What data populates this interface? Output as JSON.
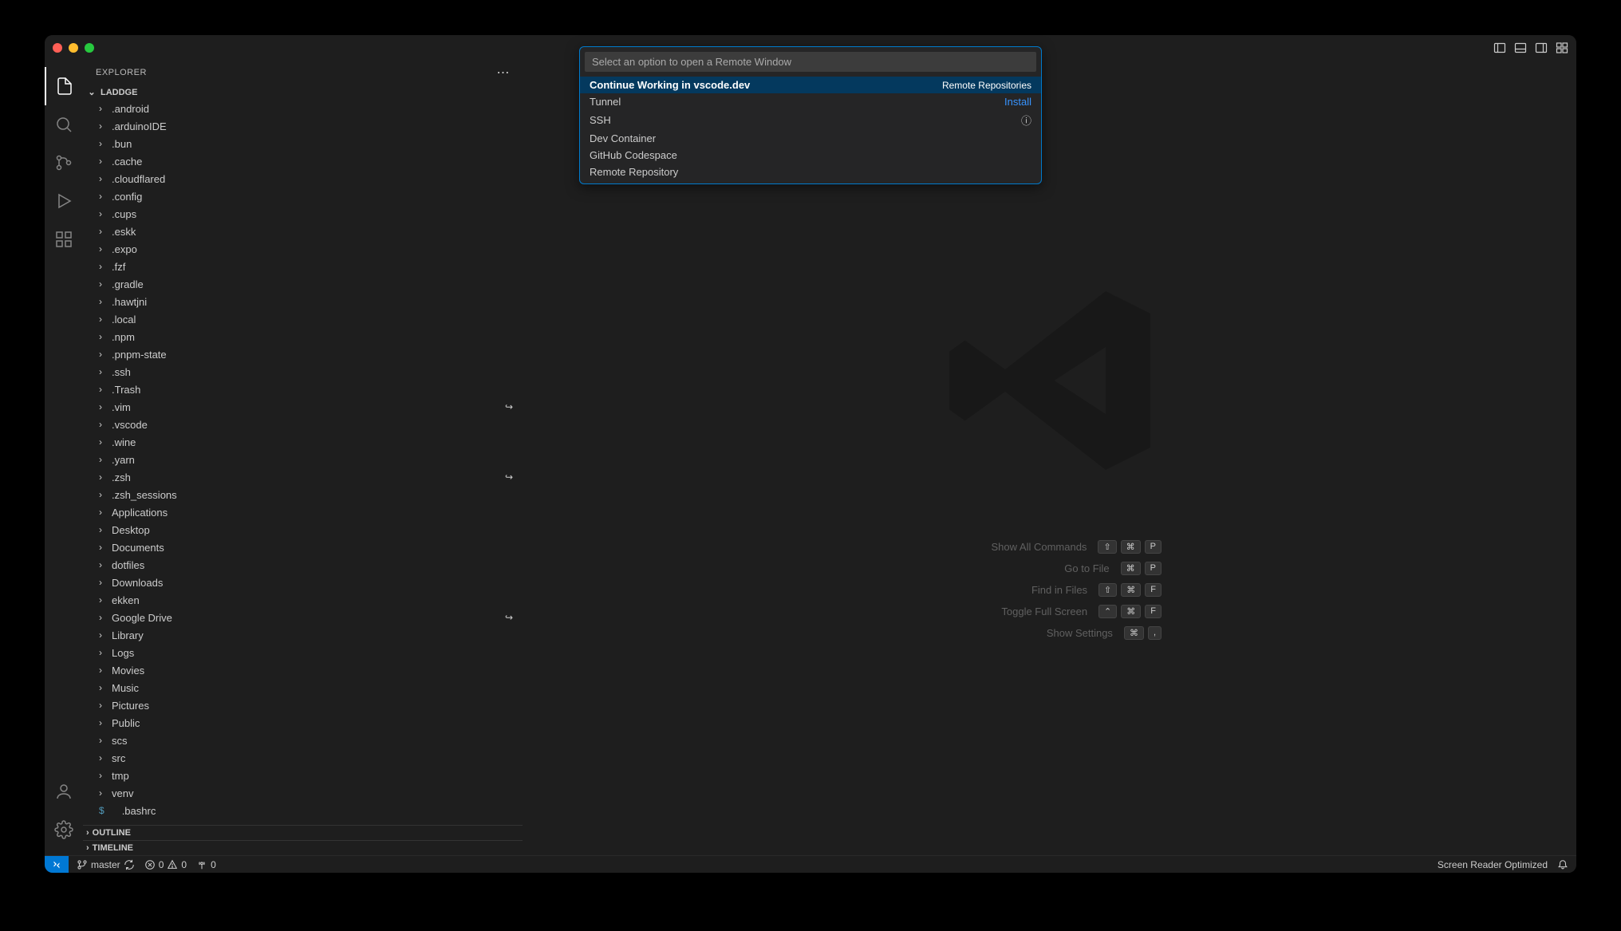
{
  "titlebar": {},
  "sidebar": {
    "title": "EXPLORER",
    "workspace": "LADDGE",
    "outline": "OUTLINE",
    "timeline": "TIMELINE",
    "items": [
      {
        "name": ".android",
        "link": false
      },
      {
        "name": ".arduinoIDE",
        "link": false
      },
      {
        "name": ".bun",
        "link": false
      },
      {
        "name": ".cache",
        "link": false
      },
      {
        "name": ".cloudflared",
        "link": false
      },
      {
        "name": ".config",
        "link": false
      },
      {
        "name": ".cups",
        "link": false
      },
      {
        "name": ".eskk",
        "link": false
      },
      {
        "name": ".expo",
        "link": false
      },
      {
        "name": ".fzf",
        "link": false
      },
      {
        "name": ".gradle",
        "link": false
      },
      {
        "name": ".hawtjni",
        "link": false
      },
      {
        "name": ".local",
        "link": false
      },
      {
        "name": ".npm",
        "link": false
      },
      {
        "name": ".pnpm-state",
        "link": false
      },
      {
        "name": ".ssh",
        "link": false
      },
      {
        "name": ".Trash",
        "link": false
      },
      {
        "name": ".vim",
        "link": true
      },
      {
        "name": ".vscode",
        "link": false
      },
      {
        "name": ".wine",
        "link": false
      },
      {
        "name": ".yarn",
        "link": false
      },
      {
        "name": ".zsh",
        "link": true
      },
      {
        "name": ".zsh_sessions",
        "link": false
      },
      {
        "name": "Applications",
        "link": false
      },
      {
        "name": "Desktop",
        "link": false
      },
      {
        "name": "Documents",
        "link": false
      },
      {
        "name": "dotfiles",
        "link": false
      },
      {
        "name": "Downloads",
        "link": false
      },
      {
        "name": "ekken",
        "link": false
      },
      {
        "name": "Google Drive",
        "link": true
      },
      {
        "name": "Library",
        "link": false
      },
      {
        "name": "Logs",
        "link": false
      },
      {
        "name": "Movies",
        "link": false
      },
      {
        "name": "Music",
        "link": false
      },
      {
        "name": "Pictures",
        "link": false
      },
      {
        "name": "Public",
        "link": false
      },
      {
        "name": "scs",
        "link": false
      },
      {
        "name": "src",
        "link": false
      },
      {
        "name": "tmp",
        "link": false
      },
      {
        "name": "venv",
        "link": false
      }
    ],
    "file": ".bashrc"
  },
  "quickpick": {
    "placeholder": "Select an option to open a Remote Window",
    "items": [
      {
        "label": "Continue Working in vscode.dev",
        "detail": "Remote Repositories",
        "selected": true
      },
      {
        "label": "Tunnel",
        "detail_link": "Install"
      },
      {
        "label": "SSH",
        "info": true
      },
      {
        "label": "Dev Container"
      },
      {
        "label": "GitHub Codespace"
      },
      {
        "label": "Remote Repository"
      }
    ]
  },
  "welcome": {
    "shortcuts": [
      {
        "label": "Show All Commands",
        "keys": [
          "⇧",
          "⌘",
          "P"
        ]
      },
      {
        "label": "Go to File",
        "keys": [
          "⌘",
          "P"
        ]
      },
      {
        "label": "Find in Files",
        "keys": [
          "⇧",
          "⌘",
          "F"
        ]
      },
      {
        "label": "Toggle Full Screen",
        "keys": [
          "⌃",
          "⌘",
          "F"
        ]
      },
      {
        "label": "Show Settings",
        "keys": [
          "⌘",
          ","
        ]
      }
    ]
  },
  "statusbar": {
    "branch": "master",
    "errors": "0",
    "warnings": "0",
    "ports": "0",
    "screenreader": "Screen Reader Optimized"
  }
}
